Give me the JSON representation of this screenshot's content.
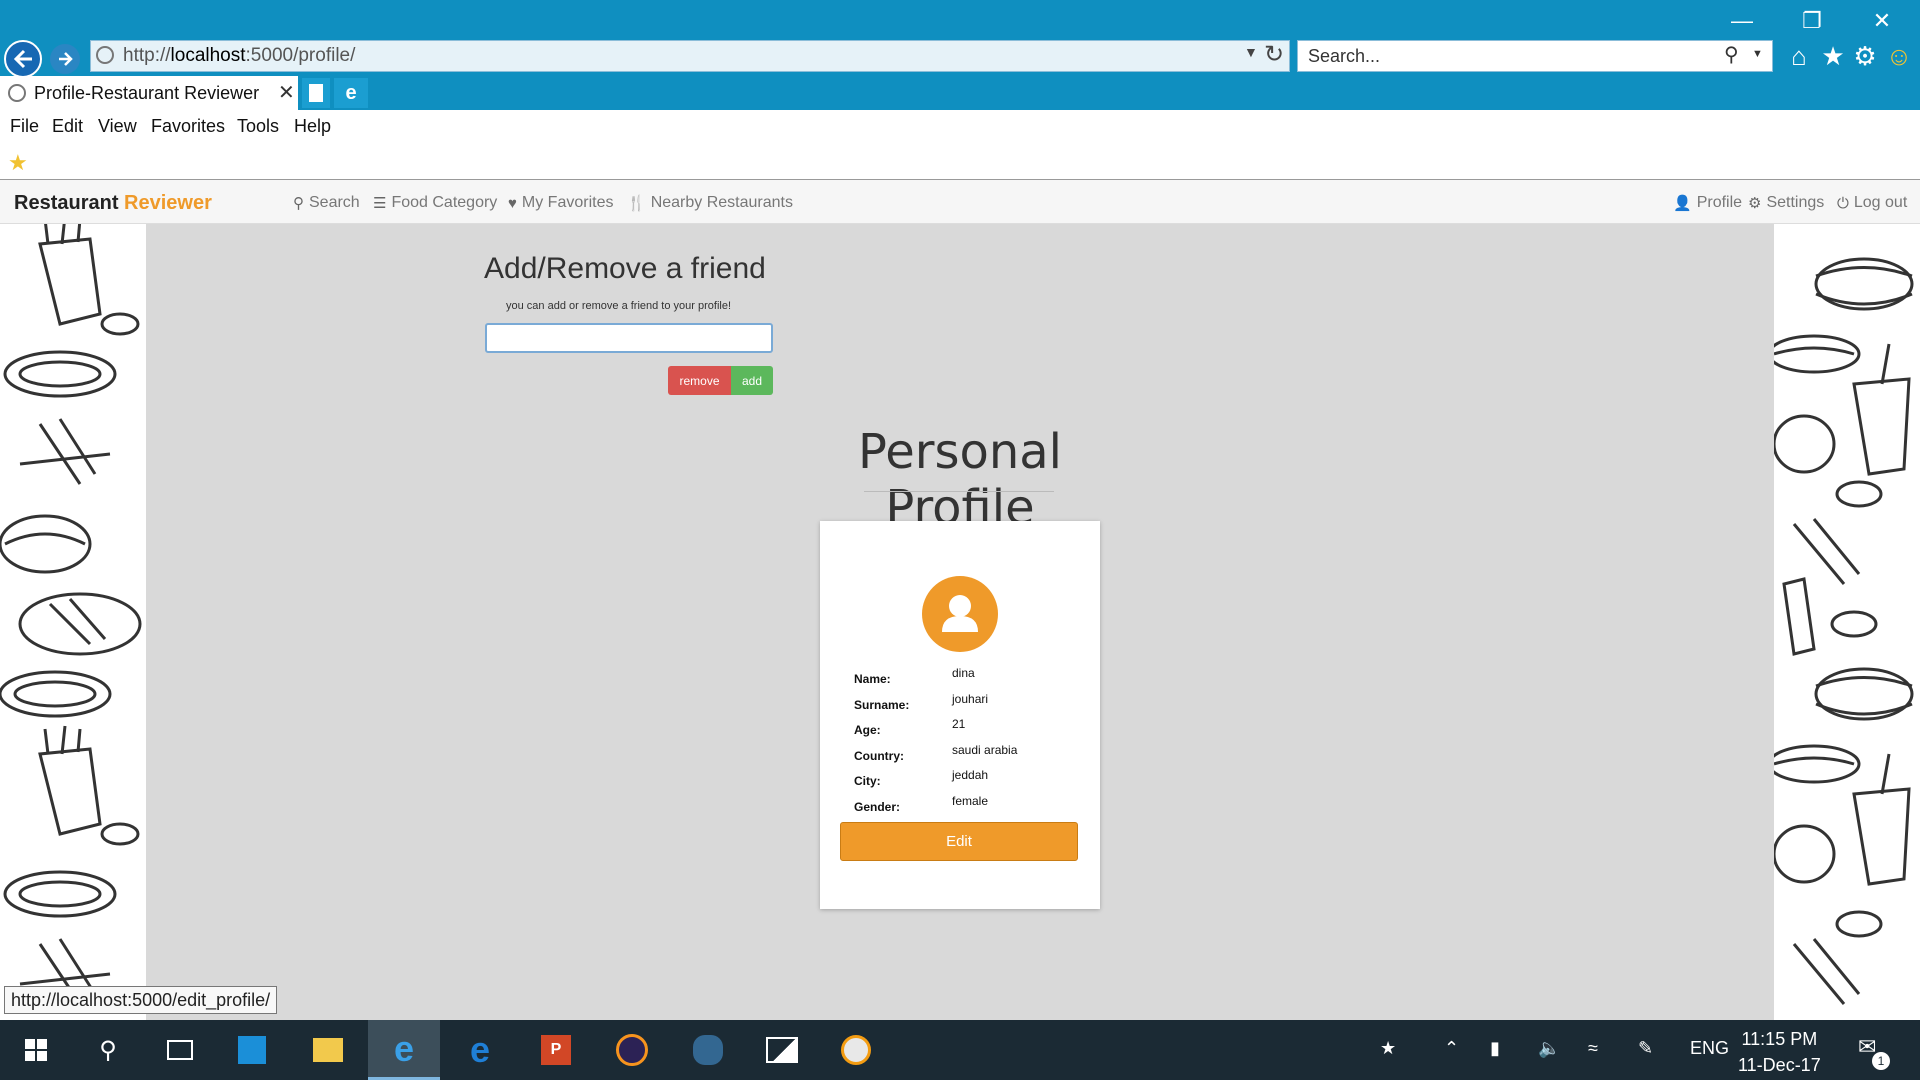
{
  "browser": {
    "url_prefix": "http://",
    "url_host": "localhost",
    "url_rest": ":5000/profile/",
    "search_placeholder": "Search...",
    "tab_title": "Profile-Restaurant Reviewer",
    "menu": [
      "File",
      "Edit",
      "View",
      "Favorites",
      "Tools",
      "Help"
    ],
    "status_url": "http://localhost:5000/edit_profile/"
  },
  "site": {
    "brand_main": "Restaurant ",
    "brand_accent": "Reviewer",
    "nav_left": [
      {
        "label": "Search",
        "icon": "search-icon"
      },
      {
        "label": "Food Category",
        "icon": "list-icon"
      },
      {
        "label": "My Favorites",
        "icon": "heart-icon"
      },
      {
        "label": "Nearby Restaurants",
        "icon": "cutlery-icon"
      }
    ],
    "nav_right": [
      {
        "label": "Profile",
        "icon": "user-icon"
      },
      {
        "label": "Settings",
        "icon": "gear-icon"
      },
      {
        "label": "Log out",
        "icon": "power-icon"
      }
    ]
  },
  "friend": {
    "title": "Add/Remove a friend",
    "subtitle": "you can add or remove a friend to your profile!",
    "input_value": "",
    "remove_label": "remove",
    "add_label": "add"
  },
  "profile": {
    "title": "Personal Profile",
    "fields": [
      {
        "label": "Name:",
        "value": "dina"
      },
      {
        "label": "Surname:",
        "value": "jouhari"
      },
      {
        "label": "Age:",
        "value": "21"
      },
      {
        "label": "Country:",
        "value": "saudi arabia"
      },
      {
        "label": "City:",
        "value": "jeddah"
      },
      {
        "label": "Gender:",
        "value": "female"
      }
    ],
    "edit_label": "Edit"
  },
  "taskbar": {
    "language": "ENG",
    "time": "11:15 PM",
    "date": "11-Dec-17",
    "notification_count": "1"
  },
  "colors": {
    "accent": "#ef9a2a",
    "danger": "#d9534f",
    "success": "#5cb85c",
    "chrome": "#0f8fc0"
  }
}
